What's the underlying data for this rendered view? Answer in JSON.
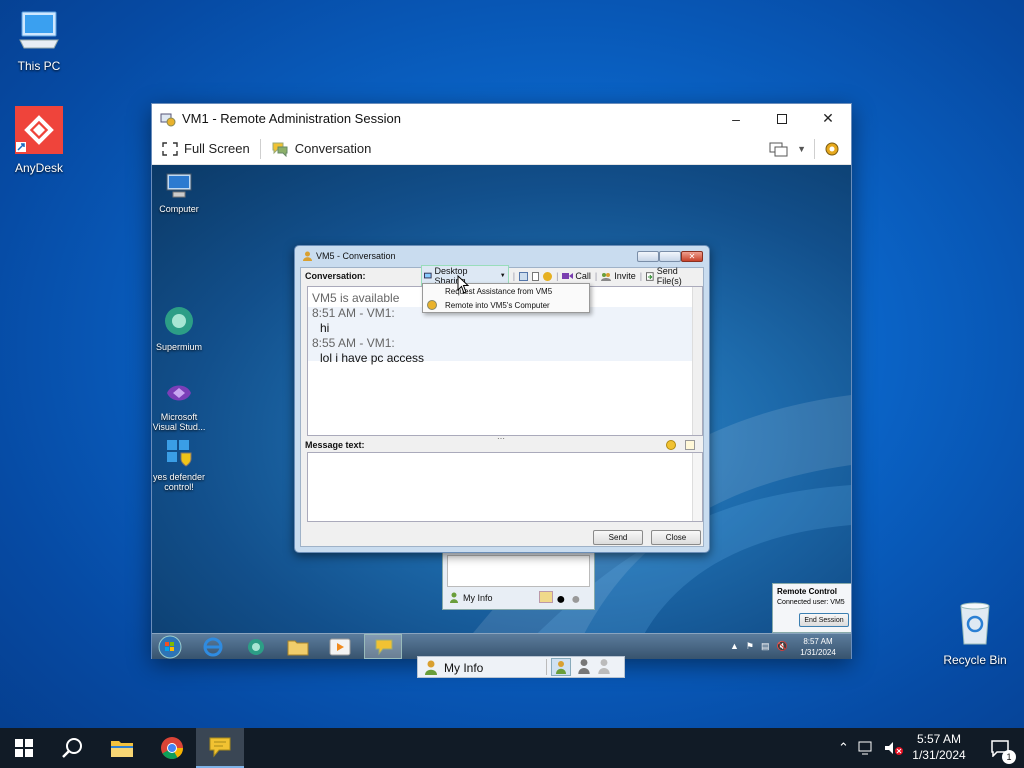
{
  "desktop": {
    "icons": [
      {
        "label": "This PC"
      },
      {
        "label": "AnyDesk"
      },
      {
        "label": "Recycle Bin"
      }
    ]
  },
  "window": {
    "title": "VM1 - Remote Administration Session",
    "toolbar": {
      "fullscreen_label": "Full Screen",
      "conversation_label": "Conversation"
    }
  },
  "remote_desktop": {
    "icons": [
      {
        "label": "Computer"
      },
      {
        "label": "Supermium"
      },
      {
        "label": "Microsoft Visual Stud..."
      },
      {
        "label": "yes defender control!"
      }
    ],
    "conversation": {
      "title": "VM5 - Conversation",
      "conversation_label": "Conversation:",
      "toolbar": {
        "desktop_sharing": "Desktop Sharing",
        "call": "Call",
        "invite": "Invite",
        "send_files": "Send File(s)"
      },
      "dropdown": [
        "Request Assistance from VM5",
        "Remote into VM5's Computer"
      ],
      "messages": {
        "status": "VM5 is available",
        "m1_header": "8:51 AM - VM1:",
        "m1_body": "hi",
        "m2_header": "8:55 AM - VM1:",
        "m2_body": "lol i have pc access"
      },
      "message_text_label": "Message text:",
      "send": "Send",
      "close": "Close"
    },
    "contacts": {
      "my_info": "My Info"
    },
    "remote_control": {
      "title": "Remote Control",
      "connected": "Connected user:  VM5",
      "end_session": "End Session"
    },
    "taskbar": {
      "time": "8:57 AM",
      "date": "1/31/2024"
    }
  },
  "contacts_strip": {
    "my_info": "My Info"
  },
  "taskbar": {
    "time": "5:57 AM",
    "date": "1/31/2024",
    "notification_count": "1"
  }
}
